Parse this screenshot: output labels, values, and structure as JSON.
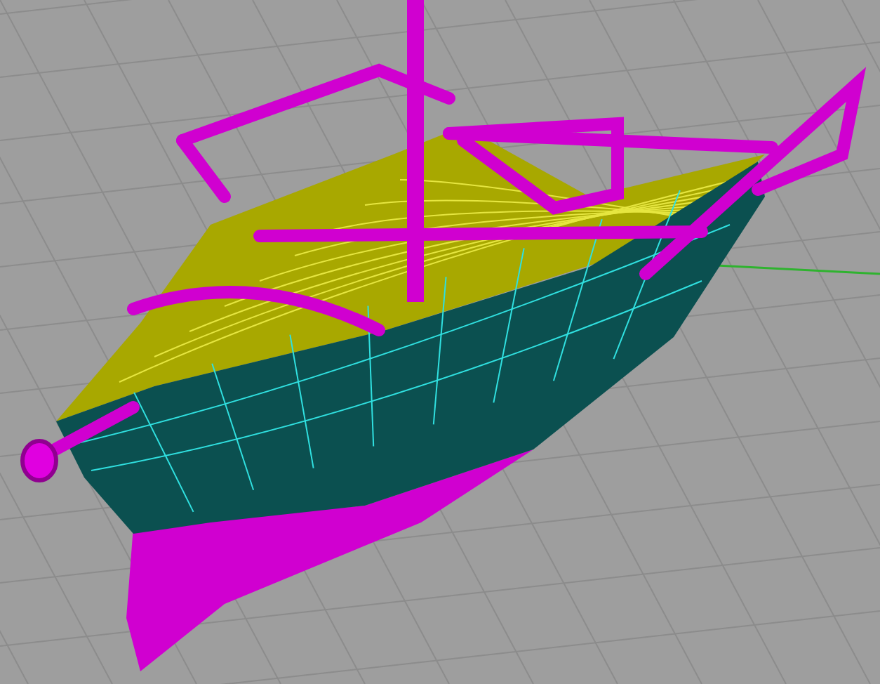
{
  "viewport": {
    "grid": true,
    "axis": true
  }
}
